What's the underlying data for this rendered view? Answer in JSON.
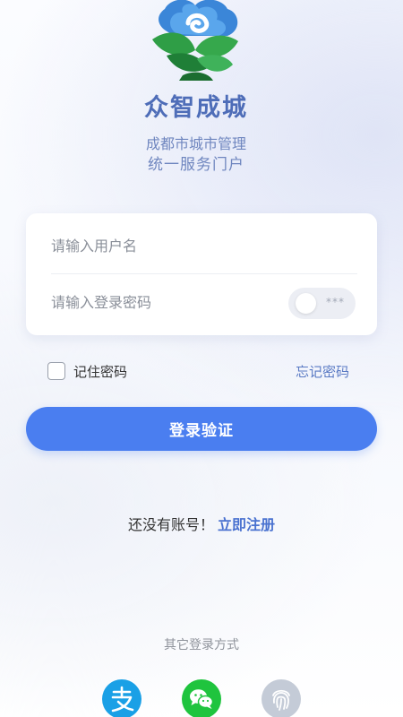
{
  "brand": {
    "name": "众智成城",
    "subtitle_1": "成都市城市管理",
    "subtitle_2": "统一服务门户"
  },
  "login_form": {
    "username_placeholder": "请输入用户名",
    "password_placeholder": "请输入登录密码",
    "password_toggle_mask": "***",
    "remember_label": "记住密码",
    "forgot_label": "忘记密码",
    "submit_label": "登录验证"
  },
  "register": {
    "prompt": "还没有账号！",
    "link": "立即注册"
  },
  "other_login": {
    "title": "其它登录方式",
    "methods": [
      "alipay",
      "wechat",
      "fingerprint"
    ]
  },
  "colors": {
    "primary": "#4a7ef0",
    "brand_text": "#4e6db8",
    "link": "#5a7ac4",
    "alipay": "#1aa0e6",
    "wechat": "#1fc43e",
    "fingerprint": "#c4cbd7"
  }
}
